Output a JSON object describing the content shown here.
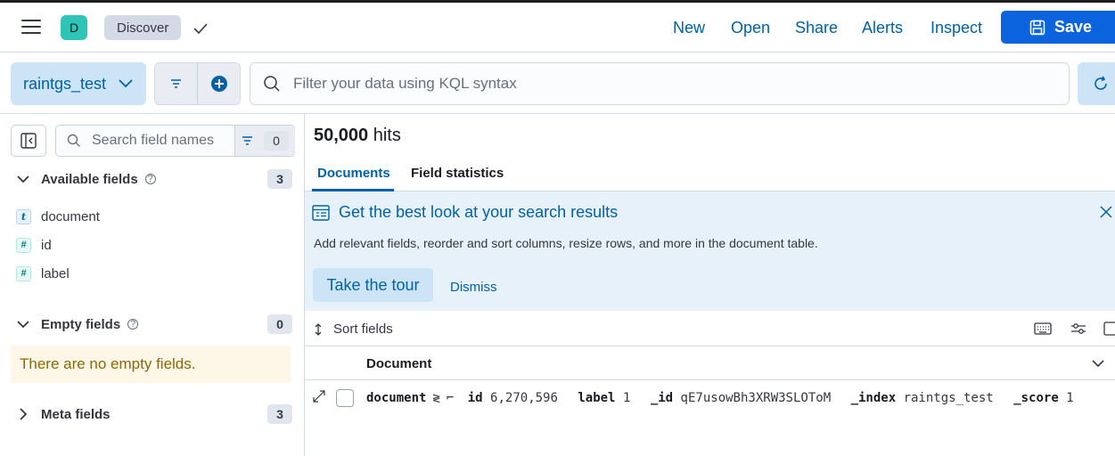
{
  "header": {
    "space_initial": "D",
    "breadcrumb": "Discover",
    "links": [
      "New",
      "Open",
      "Share",
      "Alerts",
      "Inspect"
    ],
    "save_label": "Save"
  },
  "query_bar": {
    "data_view": "raintgs_test",
    "placeholder": "Filter your data using KQL syntax"
  },
  "sidebar": {
    "search_placeholder": "Search field names",
    "filter_count": "0",
    "available": {
      "title": "Available fields",
      "count": "3",
      "fields": [
        {
          "type": "t",
          "name": "document"
        },
        {
          "type": "#",
          "name": "id"
        },
        {
          "type": "#",
          "name": "label"
        }
      ]
    },
    "empty": {
      "title": "Empty fields",
      "count": "0",
      "note": "There are no empty fields."
    },
    "meta": {
      "title": "Meta fields",
      "count": "3"
    }
  },
  "main": {
    "hits_count": "50,000",
    "hits_label": "hits",
    "tabs": [
      "Documents",
      "Field statistics"
    ],
    "callout": {
      "title": "Get the best look at your search results",
      "text": "Add relevant fields, reorder and sort columns, resize rows, and more in the document table.",
      "tour_label": "Take the tour",
      "dismiss_label": "Dismiss"
    },
    "sort_label": "Sort fields",
    "column_header": "Document",
    "row": {
      "doc_key": "document",
      "id_key": "id",
      "id_val": "6,270,596",
      "label_key": "label",
      "label_val": "1",
      "_id_key": "_id",
      "_id_val": "qE7usowBh3XRW3SLOToM",
      "_index_key": "_index",
      "_index_val": "raintgs_test",
      "_score_key": "_score",
      "_score_val": "1"
    }
  },
  "colors": {
    "primary": "#0b64dd",
    "link": "#0061a6",
    "avatar": "#2ec4b6"
  }
}
